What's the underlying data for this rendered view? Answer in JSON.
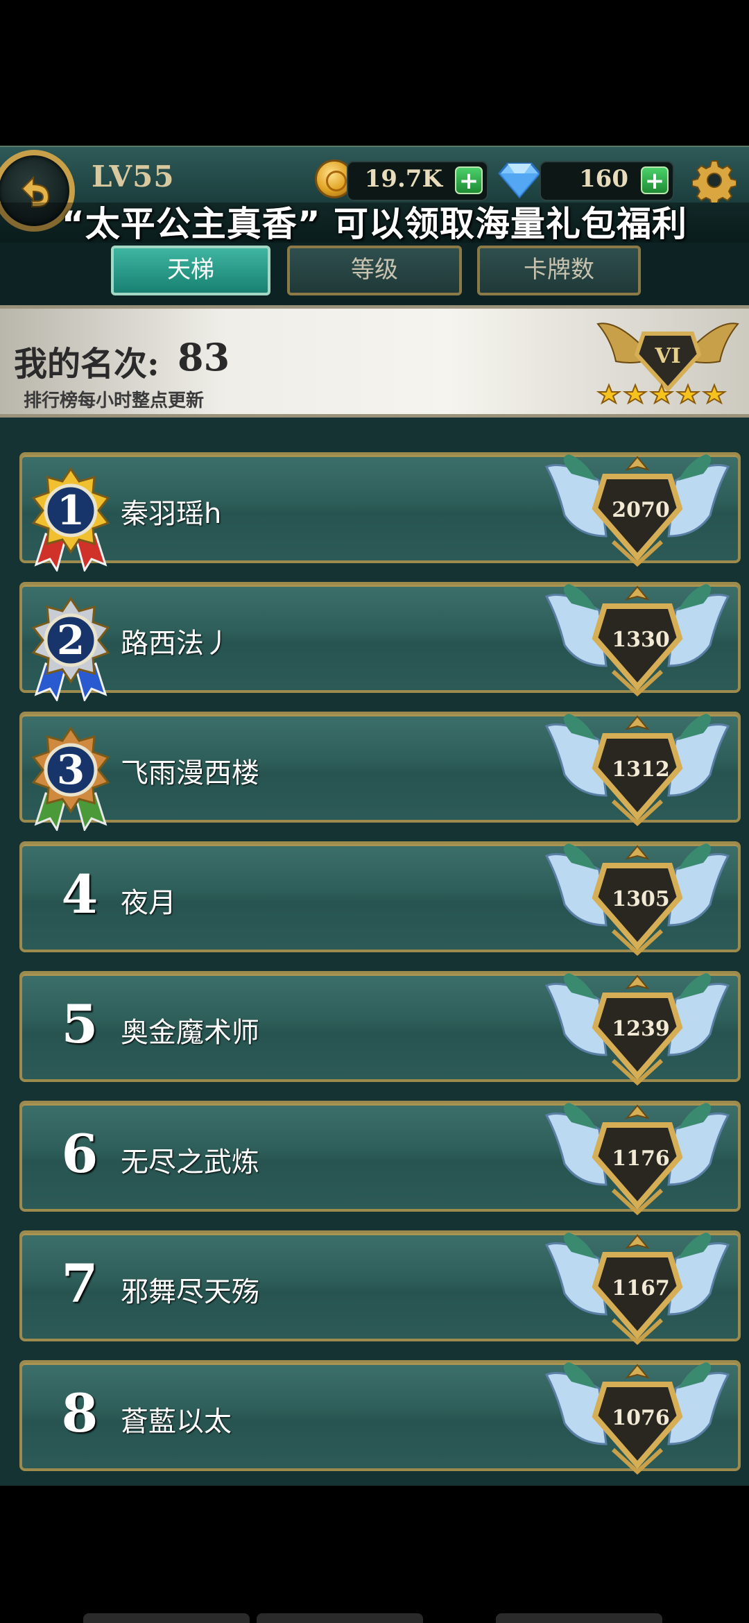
{
  "header": {
    "level": "LV55",
    "coins": "19.7K",
    "gems": "160",
    "plus": "+"
  },
  "banner": {
    "text": "“太平公主真香” 可以领取海量礼包福利"
  },
  "tabs": [
    {
      "label": "天梯",
      "active": true
    },
    {
      "label": "等级",
      "active": false
    },
    {
      "label": "卡牌数",
      "active": false
    }
  ],
  "my_rank": {
    "label": "我的名次:",
    "value": "83",
    "note": "排行榜每小时整点更新",
    "tier": "VI",
    "stars": 5
  },
  "leaderboard": [
    {
      "rank": "1",
      "name": "秦羽瑶h",
      "score": "2070"
    },
    {
      "rank": "2",
      "name": "路西法丿",
      "score": "1330"
    },
    {
      "rank": "3",
      "name": "飞雨漫西楼",
      "score": "1312"
    },
    {
      "rank": "4",
      "name": "夜月",
      "score": "1305"
    },
    {
      "rank": "5",
      "name": "奥金魔术师",
      "score": "1239"
    },
    {
      "rank": "6",
      "name": "无尽之武炼",
      "score": "1176"
    },
    {
      "rank": "7",
      "name": "邪舞尽天殇",
      "score": "1167"
    },
    {
      "rank": "8",
      "name": "蒼藍以太",
      "score": "1076"
    }
  ],
  "colors": {
    "gold": "#c9a04a",
    "active_tab": "#3fb5a0",
    "row_bg": "#2e5e59",
    "medal_gold": "#f0c030",
    "medal_silver": "#c8ccd4",
    "medal_bronze": "#d08a40"
  }
}
